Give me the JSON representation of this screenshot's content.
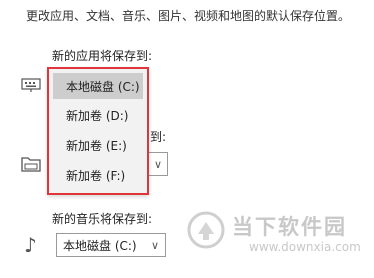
{
  "header": {
    "description": "更改应用、文档、音乐、图片、视频和地图的默认保存位置。"
  },
  "apps_section": {
    "label": "新的应用将保存到:"
  },
  "docs_section": {
    "label_tail": "到:"
  },
  "music_section": {
    "label": "新的音乐将保存到:",
    "selected_value": "本地磁盘 (C:)"
  },
  "dropdown": {
    "options": [
      "本地磁盘 (C:)",
      "新加卷 (D:)",
      "新加卷 (E:)",
      "新加卷 (F:)"
    ],
    "selected_index": 0,
    "highlight_color": "#e0353a"
  },
  "icons": {
    "apps": "monitor-keyboard-icon",
    "docs": "folder-icon",
    "music": "music-note-icon",
    "chevron": "chevron-down-icon"
  },
  "watermark": {
    "brand": "当下软件园",
    "url": "www.downxia.com"
  }
}
